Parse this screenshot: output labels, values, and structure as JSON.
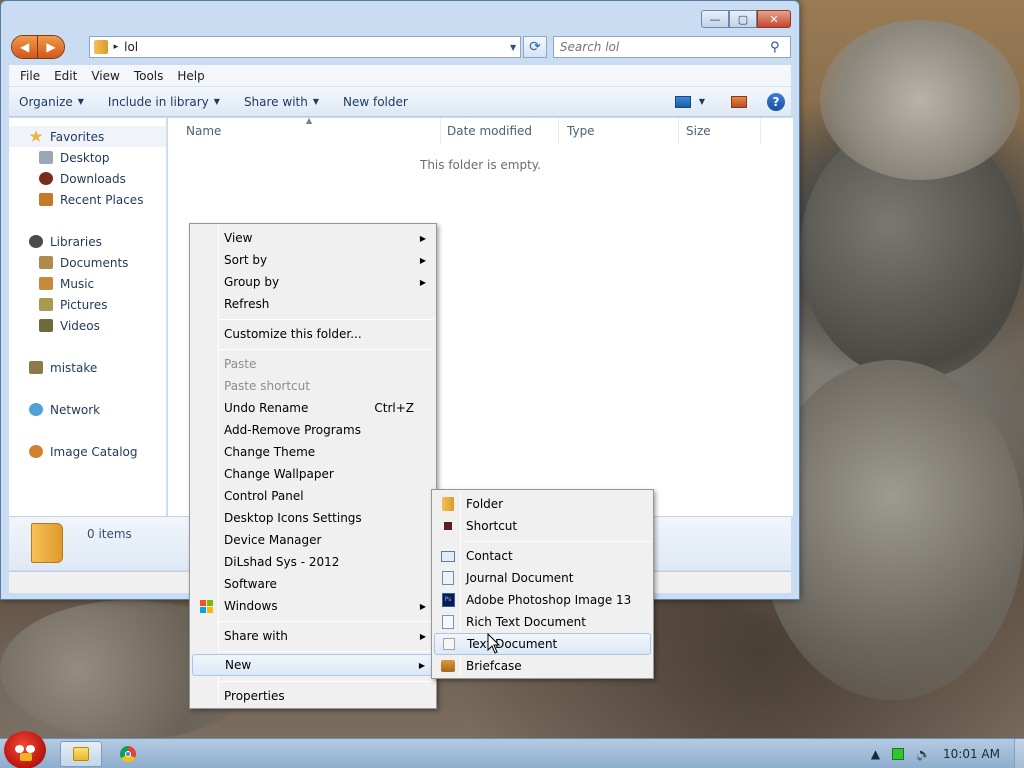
{
  "window": {
    "title_buttons": {
      "minimize": "—",
      "maximize": "▢",
      "close": "✕"
    },
    "address": {
      "path": "lol",
      "separator": "▸"
    },
    "search": {
      "placeholder": "Search lol"
    },
    "menubar": [
      "File",
      "Edit",
      "View",
      "Tools",
      "Help"
    ],
    "commands": {
      "organize": "Organize",
      "include_in_library": "Include in library",
      "share_with": "Share with",
      "new_folder": "New folder"
    },
    "nav": {
      "favorites": "Favorites",
      "desktop": "Desktop",
      "downloads": "Downloads",
      "recent_places": "Recent Places",
      "libraries": "Libraries",
      "documents": "Documents",
      "music": "Music",
      "pictures": "Pictures",
      "videos": "Videos",
      "mistake": "mistake",
      "network": "Network",
      "image_catalog": "Image Catalog"
    },
    "columns": {
      "name": "Name",
      "date_modified": "Date modified",
      "type": "Type",
      "size": "Size"
    },
    "empty_message": "This folder is empty.",
    "details": {
      "count": "0 items"
    }
  },
  "context_menu": {
    "view": "View",
    "sort_by": "Sort by",
    "group_by": "Group by",
    "refresh": "Refresh",
    "customize": "Customize this folder...",
    "paste": "Paste",
    "paste_shortcut": "Paste shortcut",
    "undo_rename": "Undo Rename",
    "undo_shortcut": "Ctrl+Z",
    "add_remove": "Add-Remove Programs",
    "change_theme": "Change Theme",
    "change_wallpaper": "Change Wallpaper",
    "control_panel": "Control Panel",
    "desktop_icons": "Desktop Icons Settings",
    "device_manager": "Device Manager",
    "dilshad": "DiLshad Sys - 2012",
    "software": "Software",
    "windows": "Windows",
    "share_with": "Share with",
    "new": "New",
    "properties": "Properties"
  },
  "new_submenu": {
    "folder": "Folder",
    "shortcut": "Shortcut",
    "contact": "Contact",
    "journal": "Journal Document",
    "photoshop": "Adobe Photoshop Image 13",
    "rtf": "Rich Text Document",
    "text": "Text Document",
    "briefcase": "Briefcase"
  },
  "taskbar": {
    "clock": "10:01 AM"
  }
}
